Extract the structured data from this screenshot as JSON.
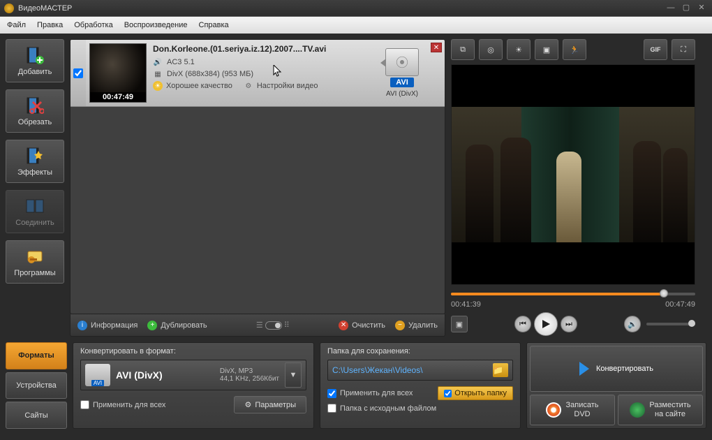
{
  "window": {
    "title": "ВидеоМАСТЕР"
  },
  "menu": {
    "file": "Файл",
    "edit": "Правка",
    "process": "Обработка",
    "play": "Воспроизведение",
    "help": "Справка"
  },
  "sidebar": {
    "add": "Добавить",
    "cut": "Обрезать",
    "effects": "Эффекты",
    "join": "Соединить",
    "programs": "Программы"
  },
  "file": {
    "name": "Don.Korleone.(01.seriya.iz.12).2007....TV.avi",
    "audio": "AC3 5.1",
    "video": "DivX (688x384) (953 МБ)",
    "quality": "Хорошее качество",
    "settings": "Настройки видео",
    "duration": "00:47:49",
    "format_badge": "AVI",
    "format_sub": "AVI (DivX)"
  },
  "listbar": {
    "info": "Информация",
    "dup": "Дублировать",
    "clear": "Очистить",
    "del": "Удалить"
  },
  "preview": {
    "pos": "00:41:39",
    "dur": "00:47:49",
    "progress_pct": 87
  },
  "tools": {
    "gif": "GIF"
  },
  "bottom": {
    "tabs": {
      "formats": "Форматы",
      "devices": "Устройства",
      "sites": "Сайты"
    },
    "convert_hdr": "Конвертировать в формат:",
    "format_name": "AVI (DivX)",
    "format_badge": "AVI",
    "format_detail1": "DivX, MP3",
    "format_detail2": "44,1 KHz, 256Кбит",
    "apply_all": "Применить для всех",
    "params": "Параметры",
    "save_hdr": "Папка для сохранения:",
    "path": "C:\\Users\\Жекан\\Videos\\",
    "apply_all2": "Применить для всех",
    "src_folder": "Папка с исходным файлом",
    "open_folder": "Открыть папку",
    "convert": "Конвертировать",
    "burn1": "Записать",
    "burn2": "DVD",
    "upload1": "Разместить",
    "upload2": "на сайте"
  }
}
